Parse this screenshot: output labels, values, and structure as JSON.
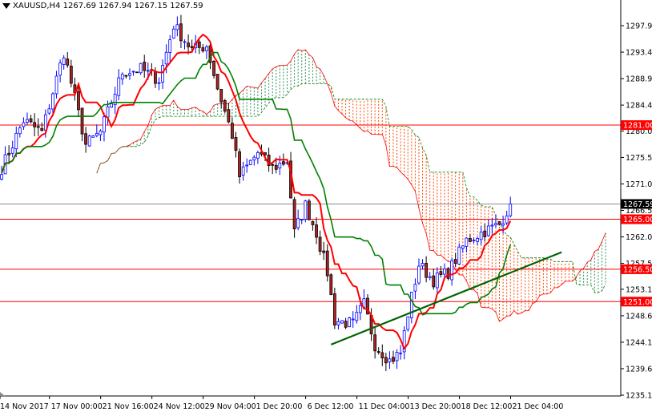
{
  "header": {
    "symbol": "XAUUSD,H4",
    "ohlc": "1267.69 1267.94 1267.15 1267.59"
  },
  "chart_data": {
    "type": "candlestick",
    "title": "XAUUSD,H4 1267.69 1267.94 1267.15 1267.59",
    "indicator": "Ichimoku Kinko Hyo (9,26,52)",
    "ylim": [
      1235.1,
      1297.9
    ],
    "y_ticks": [
      "1297.90",
      "1293.40",
      "1288.90",
      "1284.40",
      "1280.00",
      "1275.50",
      "1271.00",
      "1266.50",
      "1262.00",
      "1257.50",
      "1253.10",
      "1248.60",
      "1244.10",
      "1239.60",
      "1235.10"
    ],
    "x_ticks": [
      "14 Nov 2017",
      "17 Nov 00:00",
      "21 Nov 16:00",
      "24 Nov 12:00",
      "29 Nov 04:00",
      "1 Dec 20:00",
      "6 Dec 12:00",
      "11 Dec 04:00",
      "13 Dec 20:00",
      "18 Dec 12:00",
      "21 Dec 04:00"
    ],
    "close_anchors": [
      [
        0,
        1273.7
      ],
      [
        6,
        1281.8
      ],
      [
        11,
        1279.8
      ],
      [
        17,
        1293.4
      ],
      [
        23,
        1277.7
      ],
      [
        27,
        1279.8
      ],
      [
        33,
        1290.0
      ],
      [
        38,
        1290.5
      ],
      [
        43,
        1288.7
      ],
      [
        47,
        1298.0
      ],
      [
        52,
        1293.8
      ],
      [
        56,
        1294.5
      ],
      [
        59,
        1287.3
      ],
      [
        63,
        1279.3
      ],
      [
        65,
        1272.3
      ],
      [
        70,
        1276.3
      ],
      [
        74,
        1273.7
      ],
      [
        78,
        1275.0
      ],
      [
        80,
        1262.7
      ],
      [
        83,
        1267.4
      ],
      [
        86,
        1262.7
      ],
      [
        89,
        1256.0
      ],
      [
        91,
        1247.8
      ],
      [
        96,
        1247.2
      ],
      [
        99,
        1250.6
      ],
      [
        102,
        1243.7
      ],
      [
        106,
        1241.0
      ],
      [
        109,
        1242.3
      ],
      [
        111,
        1249.0
      ],
      [
        114,
        1257.3
      ],
      [
        118,
        1254.6
      ],
      [
        122,
        1256.0
      ],
      [
        127,
        1261.4
      ],
      [
        131,
        1262.7
      ],
      [
        136,
        1264.1
      ],
      [
        139,
        1267.59
      ]
    ],
    "levels": [
      {
        "price": 1281.0,
        "label": "1281.00"
      },
      {
        "price": 1265.0,
        "label": "1265.00"
      },
      {
        "price": 1256.5,
        "label": "1256.50"
      },
      {
        "price": 1251.0,
        "label": "1251.00"
      }
    ],
    "current_price": {
      "price": 1267.59,
      "label": "1267.59"
    },
    "trendline": {
      "from": [
        90,
        1243.7
      ],
      "to": [
        153,
        1259.4
      ]
    },
    "colors": {
      "bull": "#0000ff",
      "bear": "#b22222",
      "tenkan": "#ff0000",
      "kijun": "#008000",
      "cloud_bear": "#ff4500",
      "cloud_bull": "#2e8b57",
      "level": "#ff0000",
      "trend": "#006400"
    }
  }
}
